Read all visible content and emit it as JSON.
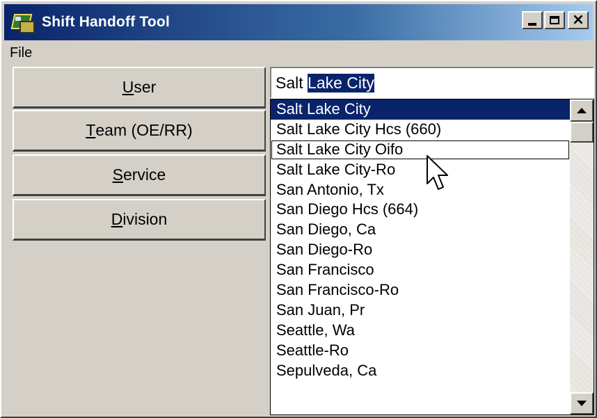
{
  "window": {
    "title": "Shift Handoff Tool",
    "icon": "app-map-icon",
    "controls": [
      "minimize-icon",
      "maximize-icon",
      "close-icon"
    ]
  },
  "menu": {
    "file": "File"
  },
  "nav": {
    "user": {
      "accel": "U",
      "rest": "ser"
    },
    "team": {
      "accel": "T",
      "rest": "eam (OE/RR)"
    },
    "service": {
      "accel": "S",
      "rest": "ervice"
    },
    "division": {
      "accel": "D",
      "rest": "ivision"
    }
  },
  "combo": {
    "typed": "Salt ",
    "autocomplete": "Lake City"
  },
  "list": {
    "items": [
      "Salt Lake City",
      "Salt Lake City Hcs (660)",
      "Salt Lake City Oifo",
      "Salt Lake City-Ro",
      "San Antonio, Tx",
      "San Diego Hcs (664)",
      "San Diego, Ca",
      "San Diego-Ro",
      "San Francisco",
      "San Francisco-Ro",
      "San Juan, Pr",
      "Seattle, Wa",
      "Seattle-Ro",
      "Sepulveda, Ca"
    ],
    "selected_index": 0,
    "focused_index": 2
  },
  "colors": {
    "selection": "#0a246a",
    "face": "#d4d0c8"
  }
}
